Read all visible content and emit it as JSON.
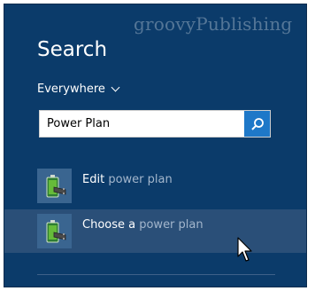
{
  "watermark": "groovyPublishing",
  "search": {
    "title": "Search",
    "scope_label": "Everywhere",
    "query": "Power Plan"
  },
  "results": [
    {
      "highlight": "Edit",
      "rest": " power plan",
      "icon": "power-plan-battery-icon"
    },
    {
      "highlight": "Choose a",
      "rest": " power plan",
      "icon": "power-plan-battery-icon"
    }
  ],
  "colors": {
    "background": "#0b3b6a",
    "selected_row": "#2a4f78",
    "search_button": "#1e78c8"
  }
}
